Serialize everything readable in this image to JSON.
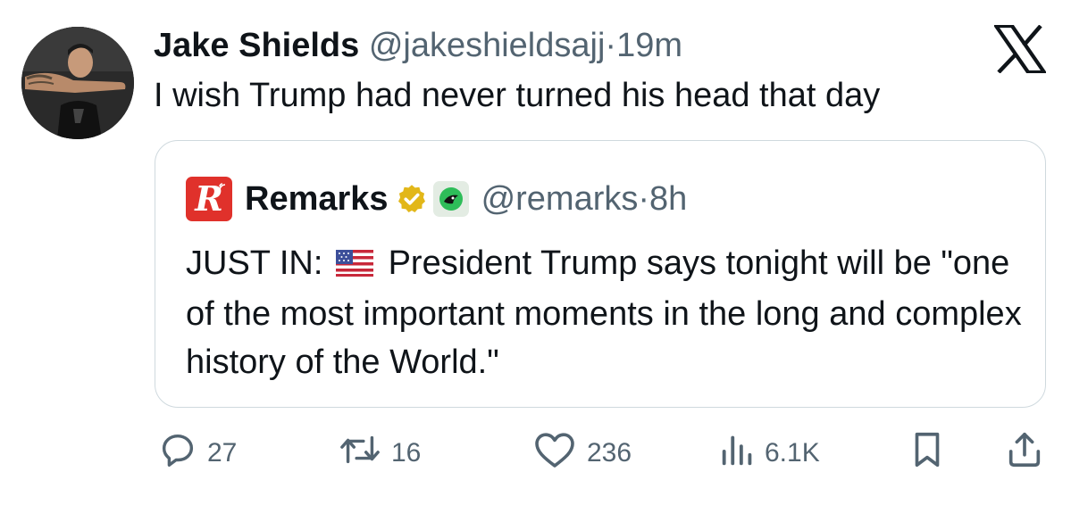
{
  "tweet": {
    "author_name": "Jake Shields",
    "author_handle": "@jakeshieldsajj",
    "separator": "·",
    "time": "19m",
    "text": "I wish Trump had never turned his head that day"
  },
  "quote": {
    "logo_letter": "R",
    "author_name": "Remarks",
    "author_handle": "@remarks",
    "separator": "·",
    "time": "8h",
    "text_prefix": "JUST IN:",
    "text_body": "President Trump says tonight will be \"one of the most important moments in the long and complex history of the World.\""
  },
  "actions": {
    "replies": "27",
    "reposts": "16",
    "likes": "236",
    "views": "6.1K"
  },
  "icons": {
    "platform_logo": "x-logo-icon",
    "verified": "verified-badge-icon",
    "affiliate": "affiliate-badge-icon",
    "flag": "us-flag-icon",
    "reply": "reply-icon",
    "repost": "repost-icon",
    "like": "heart-icon",
    "views": "views-icon",
    "bookmark": "bookmark-icon",
    "share": "share-icon"
  },
  "colors": {
    "text": "#0f1419",
    "secondary": "#536471",
    "border": "#cfd9de",
    "brand_red": "#e0312b",
    "verified_gold": "#e2b719"
  }
}
